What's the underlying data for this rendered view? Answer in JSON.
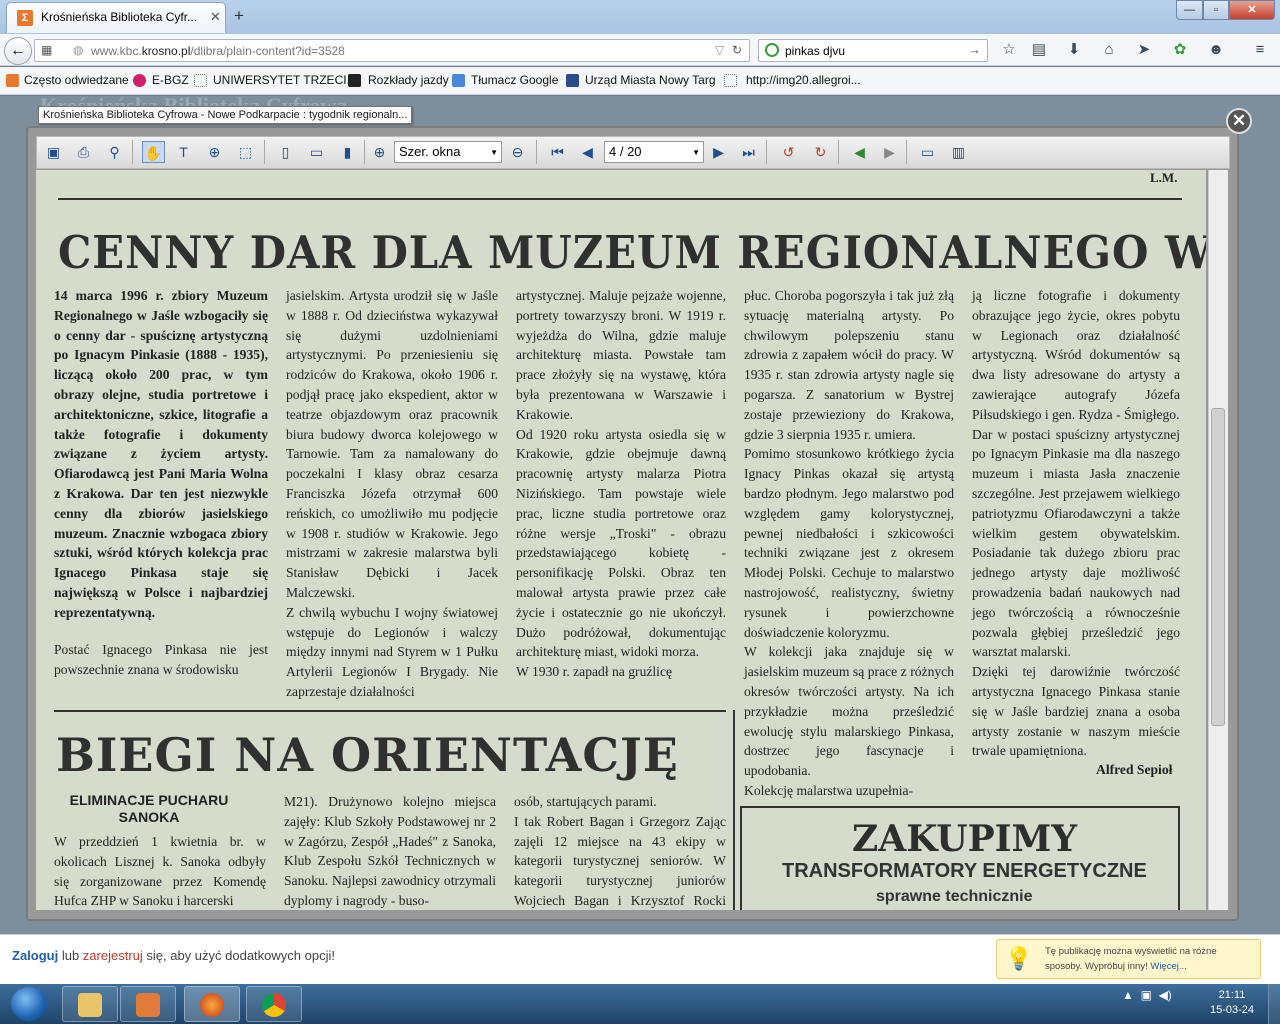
{
  "browser": {
    "tab_title": "Krośnieńska Biblioteka Cyfr...",
    "tab_favicon": "Σ",
    "url_prefix": "www.kbc.",
    "url_domain": "krosno.pl",
    "url_rest": "/dlibra/plain-content?id=3528",
    "search_value": "pinkas djvu",
    "window_buttons": {
      "minimize": "—",
      "maximize": "▫",
      "close": "✕"
    }
  },
  "bookmarks": {
    "items": [
      "Często odwiedzane",
      "E-BGZ",
      "UNIWERSYTET TRZECI...",
      "Rozkłady jazdy",
      "Tłumacz Google",
      "Urząd Miasta Nowy Targ",
      "http://img20.allegroi..."
    ]
  },
  "page": {
    "header_faded": "Krośnieńska Biblioteka Cyfrowa",
    "tooltip": "Krośnieńska Biblioteka Cyfrowa - Nowe Podkarpacie : tygodnik regionaln..."
  },
  "viewer": {
    "zoom_value": "Szer. okna",
    "page_value": "4 / 20",
    "close_glyph": "✕"
  },
  "article": {
    "top_initials": "L.M.",
    "headline": "CENNY DAR DLA MUZEUM REGIONALNEGO W JAŚLE",
    "col1_bold": "     14 marca 1996 r. zbiory Muzeum Regionalnego w Jaśle wzbogaciły się o cenny dar - spuściznę artystyczną po Ignacym Pinkasie (1888 - 1935), liczącą około 200 prac, w tym obrazy olejne, studia portretowe i architektoniczne, szkice, litografie a także fotografie i dokumenty związane z życiem artysty. Ofiarodawcą jest Pani Maria Wolna z Krakowa. Dar ten jest niezwykle cenny dla zbiorów jasielskiego muzeum. Znacznie wzbogaca zbiory sztuki, wśród których kolekcja prac Ignacego Pinkasa staje się największą w Polsce i najbardziej reprezentatywną.",
    "col1_tail": "     Postać Ignacego Pinkasa nie jest powszechnie znana w środowisku",
    "col2": "jasielskim. Artysta urodził się w Jaśle w 1888 r. Od dzieciństwa wykazywał się dużymi uzdolnieniami artystycznymi. Po przeniesieniu się rodziców do Krakowa, około 1906 r. podjął pracę jako ekspedient, aktor w teatrze objazdowym oraz pracownik biura budowy dworca kolejowego w Tarnowie. Tam za namalowany do poczekalni I klasy obraz cesarza Franciszka Józefa otrzymał 600 reńskich, co umożliwiło mu podjęcie w 1908 r. studiów w Krakowie. Jego mistrzami w zakresie malarstwa byli Stanisław Dębicki i Jacek Malczewski.\n     Z chwilą wybuchu I wojny światowej wstępuje do Legionów i walczy między innymi nad Styrem w 1 Pułku Artylerii Legionów I Brygady. Nie zaprzestaje działalności",
    "col3": "artystycznej. Maluje pejzaże wojenne, portrety towarzyszy broni. W 1919 r. wyjeżdża do Wilna, gdzie maluje architekturę miasta. Powstałe tam prace złożyły się na wystawę, która była prezentowana w Warszawie i Krakowie.\n     Od 1920 roku artysta osiedla się w Krakowie, gdzie obejmuje dawną pracownię artysty malarza Piotra Nizińskiego. Tam powstaje wiele prac, liczne studia portretowe oraz różne wersje „Troski\" - obrazu przedstawiającego kobietę - personifikację Polski. Obraz ten malował artysta prawie przez całe życie i ostatecznie go nie ukończył. Dużo podróżował, dokumentując architekturę miast, widoki morza.\n     W 1930 r. zapadł na gruźlicę",
    "col4": "płuc. Choroba pogorszyła i tak już złą sytuację materialną artysty. Po chwilowym polepszeniu stanu zdrowia z zapałem wócił do pracy. W 1935 r. stan zdrowia artysty nagle się pogarsza. Z sanatorium w Bystrej zostaje przewieziony do Krakowa, gdzie 3 sierpnia 1935 r. umiera.\n     Pomimo stosunkowo krótkiego życia Ignacy Pinkas okazał się artystą bardzo płodnym. Jego malarstwo pod względem gamy kolorystycznej, pewnej niedbałości i szkicowości techniki związane jest z okresem Młodej Polski. Cechuje to malarstwo nastrojowość, realistyczny, świetny rysunek i powierzchowne doświadczenie koloryzmu.\n     W kolekcji jaka znajduje się w jasielskim muzeum są prace z różnych okresów twórczości artysty. Na ich przykładzie można prześledzić ewolucję stylu malarskiego Pinkasa, dostrzec jego fascynacje i upodobania.\n     Kolekcję malarstwa uzupełnia-",
    "col5": "ją liczne fotografie i dokumenty obrazujące jego życie, okres pobytu w Legionach oraz działalność artystyczną. Wśród dokumentów są dwa listy adresowane do artysty a zawierające autografy Józefa Piłsudskiego i gen. Rydza - Śmigłego.\n     Dar w postaci spuścizny artystycznej po Ignacym Pinkasie ma dla naszego muzeum i miasta Jasła znaczenie szczególne. Jest przejawem wielkiego patriotyzmu Ofiarodawczyni a także wielkim gestem obywatelskim. Posiadanie tak dużego zbioru prac jednego artysty daje możliwość prowadzenia badań naukowych nad jego twórczością a równocześnie pozwala głębiej prześledzić jego warsztat malarski.\n     Dzięki tej darowiźnie twórczość artystyczna Ignacego Pinkasa stanie się w Jaśle bardziej znana a osoba artysty zostanie w naszym mieście trwale upamiętniona.",
    "author": "Alfred Sepioł"
  },
  "article2": {
    "headline": "BIEGI NA ORIENTACJĘ",
    "subhead": "ELIMINACJE PUCHARU SANOKA",
    "col1": "     W przeddzień 1 kwietnia br. w okolicach Lisznej k. Sanoka odbyły się zorganizowane przez Komendę Hufca ZHP w Sanoku i harcerski",
    "col2": "M21). Drużynowo kolejno miejsca zajęły: Klub Szkoły Podstawowej nr 2 w Zagórzu, Zespół „Hadeś\" z Sanoka, Klub Zespołu Szkół Technicznych w Sanoku. Najlepsi zawodnicy otrzymali dyplomy i nagrody - buso-",
    "col3": "osób, startujących parami.\n     I tak Robert Bagan i Grzegorz Zając zajęli 12 miejsce na 43 ekipy w kategorii turystycznej seniorów. W kategorii turystycznej juniorów Wojciech Bagan i Krzysztof Rocki zaję-"
  },
  "ad": {
    "title": "ZAKUPIMY",
    "line1": "TRANSFORMATORY ENERGETYCZNE",
    "line2": "sprawne technicznie"
  },
  "status": {
    "login": "Zaloguj",
    "or": " lub ",
    "register": "zarejestruj",
    "rest": " się, aby użyć dodatkowych opcji!",
    "notice_text": "Tę publikację można wyświetlić na różne sposoby. Wypróbuj inny!",
    "notice_link": "Więcej..."
  },
  "taskbar": {
    "time": "21:11",
    "date": "15-03-24"
  },
  "colors": {
    "paper": "#d6dccb",
    "link": "#1f5fa8",
    "register": "#c0392b"
  }
}
